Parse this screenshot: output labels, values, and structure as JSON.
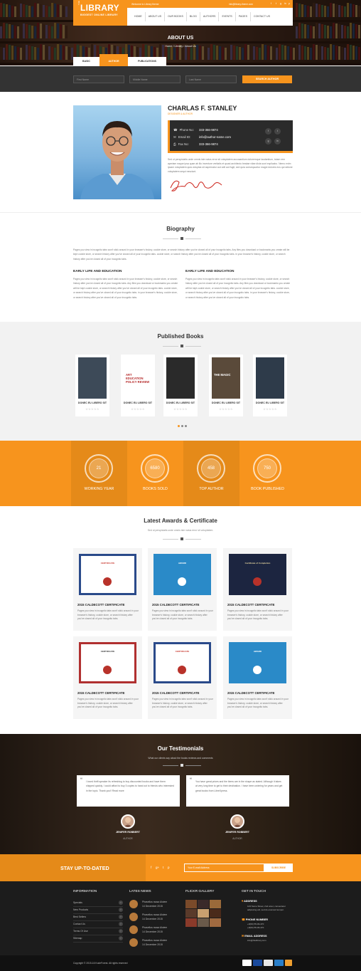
{
  "header": {
    "logo_the": "THE",
    "logo_title": "LIBRARY",
    "logo_subtitle": "BIGGEST ONLINE LIBRARY",
    "welcome": "Welcome to Library theme",
    "email": "info@library-theme.com",
    "social_icons": [
      "facebook-icon",
      "twitter-icon",
      "google-plus-icon",
      "linkedin-icon",
      "pinterest-icon"
    ],
    "nav": [
      "HOME",
      "ABOUT US",
      "OUR BOOKS",
      "BLOG",
      "AUTHORS",
      "EVENTS",
      "PAGES",
      "CONTACT US"
    ]
  },
  "hero": {
    "title": "ABOUT US",
    "breadcrumb": "Home / Library / About Us"
  },
  "tabs": [
    "BASIC",
    "AUTHOR",
    "PUBLICATIONS"
  ],
  "search": {
    "first_name": "First Name",
    "middle_name": "Middle Name",
    "last_name": "Last Name",
    "button": "SEARCH AUTHOR"
  },
  "author": {
    "name": "CHARLAS F. STANLEY",
    "role": "DESIGNER & AUTHOR",
    "phone_label": "Phone No:",
    "phone": "333-366-9874",
    "email_label": "Email ID:",
    "email": "info@author-name.com",
    "fax_label": "Fax No:",
    "fax": "333-366-9874",
    "desc": "Sed ut perspiciatis unde omnis iste natus error sit voluptatem accusantium doloremque laudantium, totam rem aperiam eaque ipsa quae ab illo inventore veritatis et quasi architecto beatae vitae dicta sunt explicabo. Nemo enim ipsam voluptatem quia voluptas sit aspernatur aut odit aut fugit, sed quia consequuntur magni dolores eos qui ratione voluptatem sequi nesciunt."
  },
  "biography": {
    "title": "Biography",
    "intro": "Pages you view in incognito tabs won't stick around in your browser's history, cookie store, or search history after you've closed all of your incognito tabs. Any files you download or bookmarks you create will be kept cookie store, or search history after you've closed all of your incognito tabs. cookie store, or search history after you've closed all of your incognito tabs. in your browser's history, cookie store, or search history after you've closed all of your incognito tabs.",
    "col1_title": "EARLY LIFE AND EDUCATION",
    "col1_text": "Pages you view in incognito tabs won't stick around in your browser's history, cookie store, or search history after you've closed all of your incognito tabs. Any files you download or bookmarks you create will be kept cookie store, or search history after you've closed all of your incognito tabs. cookie store, or search history after you've closed all of your incognito tabs. in your browser's history, cookie store, or search history after you've closed all of your incognito tabs.",
    "col2_title": "EARLY LIFE AND EDUCATION",
    "col2_text": "Pages you view in incognito tabs won't stick around in your browser's history, cookie store, or search history after you've closed all of your incognito tabs. Any files you download or bookmarks you create will be kept cookie store, or search history after you've closed all of your incognito tabs. cookie store, or search history after you've closed all of your incognito tabs. in your browser's history, cookie store, or search history after you've closed all of your incognito tabs."
  },
  "books": {
    "title": "Published Books",
    "items": [
      {
        "title": "DONEC EU LIBERO SIT",
        "cover_text": "",
        "color": "#3d4a58"
      },
      {
        "title": "DONEC EU LIBERO SIT",
        "cover_text": "ART EDUCATION POLICY REVIEW",
        "color": "#ffffff"
      },
      {
        "title": "DONEC EU LIBERO SIT",
        "cover_text": "",
        "color": "#2a2a2a"
      },
      {
        "title": "DONEC EU LIBERO SIT",
        "cover_text": "THE MAGIC",
        "color": "#5a4a3a"
      },
      {
        "title": "DONEC EU LIBERO SIT",
        "cover_text": "",
        "color": "#2e3b4a"
      }
    ],
    "stars": "☆☆☆☆☆",
    "rating": 0,
    "pages": 3
  },
  "stats": [
    {
      "value": "21",
      "label": "WORKING YEAR"
    },
    {
      "value": "6580",
      "label": "BOOKS SOLD"
    },
    {
      "value": "458",
      "label": "TOP AUTHOR"
    },
    {
      "value": "750",
      "label": "BOOK PUBLISHED"
    }
  ],
  "awards": {
    "title": "Latest Awards & Certificate",
    "subtitle": "Sed ut perspiciatis unde omnis iste natus error sit voluptatem.",
    "items": [
      {
        "title": "2015 CALDECOTT CERTIFICATE",
        "text": "Pages you view in incognito tabs won't stick around in your browser's history, cookie store, or search history after you've closed all of your incognito tabs."
      },
      {
        "title": "2015 CALDECOTT CERTIFICATE",
        "text": "Pages you view in incognito tabs won't stick around in your browser's history, cookie store, or search history after you've closed all of your incognito tabs."
      },
      {
        "title": "2015 CALDECOTT CERTIFICATE",
        "text": "Pages you view in incognito tabs won't stick around in your browser's history, cookie store, or search history after you've closed all of your incognito tabs."
      },
      {
        "title": "2015 CALDECOTT CERTIFICATE",
        "text": "Pages you view in incognito tabs won't stick around in your browser's history, cookie store, or search history after you've closed all of your incognito tabs."
      },
      {
        "title": "2015 CALDECOTT CERTIFICATE",
        "text": "Pages you view in incognito tabs won't stick around in your browser's history, cookie store, or search history after you've closed all of your incognito tabs."
      },
      {
        "title": "2015 CALDECOTT CERTIFICATE",
        "text": "Pages you view in incognito tabs won't stick around in your browser's history, cookie store, or search history after you've closed all of your incognito tabs."
      }
    ],
    "cert_texts": [
      "CERTIFICATE",
      "Certificate of Completion",
      "AWARD"
    ]
  },
  "testimonials": {
    "title": "Our Testimonials",
    "subtitle": "What our clients say about the books reviews and comments",
    "items": [
      {
        "text": "I loved thrift speaker its refreshing to buy discounted books and have them shipped quickly. I could afford to buy 3 copies to hand out to friends who interested in the topic. Thank you!! Read more",
        "name": "JENIFER ROBBERT",
        "role": "AUTHOR"
      },
      {
        "text": "You have great prices and the items are in the shape as stated. Although it takes at very long time to get to their destination. I have been ordering for years and get great books from LibreXpress.",
        "name": "JENIFER ROBBERT",
        "role": "AUTHOR"
      }
    ]
  },
  "newsletter": {
    "title": "STAY UP-TO-DATED",
    "social": [
      "f",
      "g+",
      "t",
      "p"
    ],
    "placeholder": "Your E-mail Address",
    "button": "SUBSCRIBE"
  },
  "footer": {
    "information_title": "INFORMATION",
    "information": [
      "Specials",
      "New Products",
      "Best Sellers",
      "Contact Us",
      "Terms Of Use",
      "Sitemap"
    ],
    "news_title": "LATES NEWS",
    "news": [
      {
        "title": "Phasellus rausa Aloiem",
        "date": "14 December 2015"
      },
      {
        "title": "Phasellus rausa Aloiem",
        "date": "14 December 2015"
      },
      {
        "title": "Phasellus rausa Aloiem",
        "date": "14 December 2015"
      },
      {
        "title": "Phasellus rausa Aloiem",
        "date": "14 December 2015"
      }
    ],
    "gallery_title": "FLICKR GALLERY",
    "touch_title": "GET IN TOUCH",
    "address_label": "ADDRESS",
    "address": "123 Some Street, 2nd amet, consectetur adipiscing elit, sed do eiusmod tempor.",
    "phone_label": "PHONE NUMBER",
    "phone1": "+0(60) 55-09-470",
    "phone2": "+0(60) 55-09-470",
    "email_label": "EMAIL ADDRESS",
    "email": "info@thelibrary.com",
    "copyright": "Copyright © 2015-16 KodeForest. All rights reserved",
    "payment_icons": [
      "paypal-icon",
      "visa-icon",
      "mastercard-icon",
      "amex-icon",
      "discover-icon"
    ]
  }
}
